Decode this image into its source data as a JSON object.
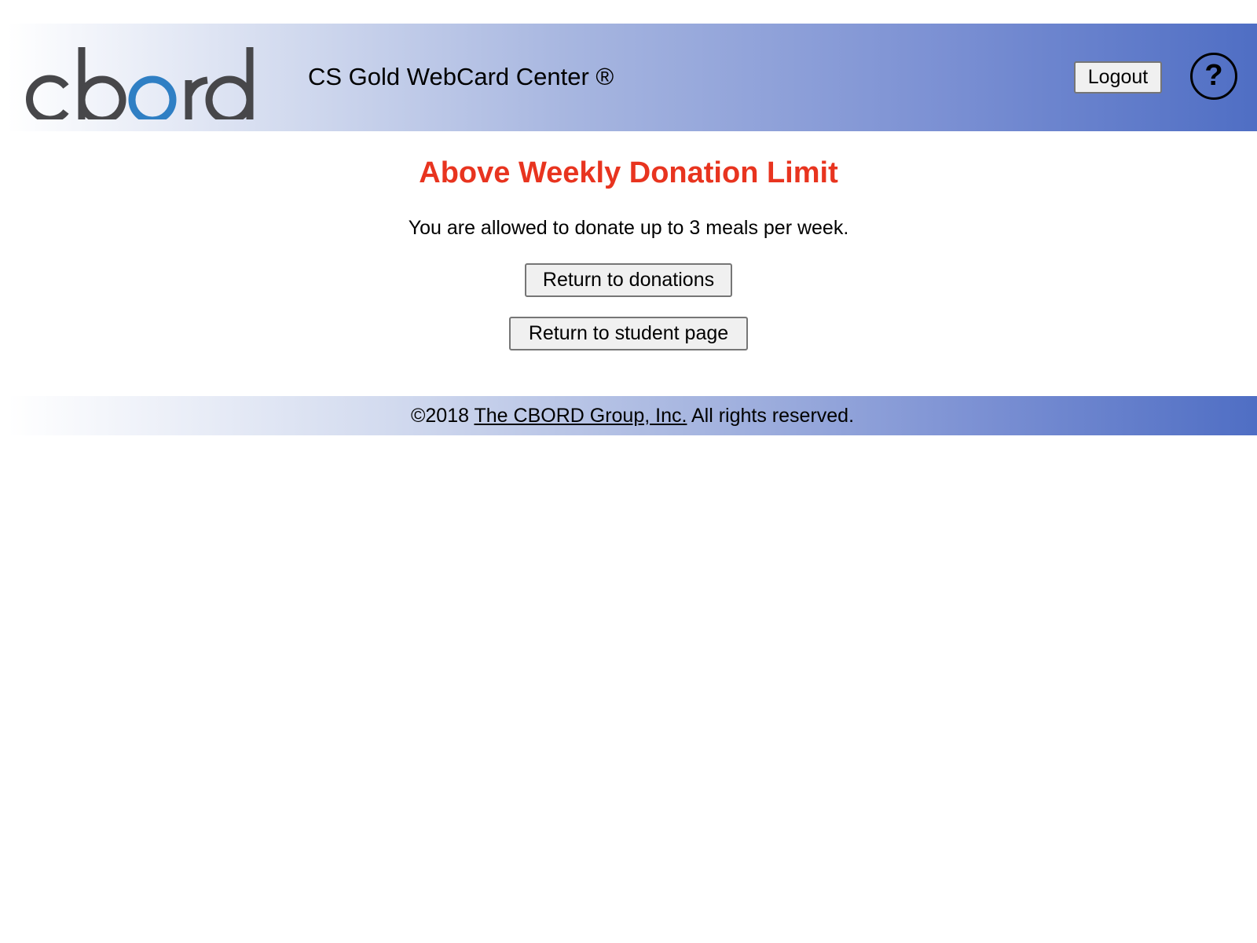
{
  "header": {
    "logo_text": "cbord",
    "logo_mark": "®",
    "app_title": "CS Gold WebCard Center ®",
    "logout_label": "Logout",
    "help_label": "?",
    "colors": {
      "logo_gray": "#47474a",
      "logo_blue": "#2f7fc4",
      "gradient_end": "#4f6ec4"
    }
  },
  "main": {
    "title": "Above Weekly Donation Limit",
    "title_color": "#e8341f",
    "message": "You are allowed to donate up to 3 meals per week.",
    "buttons": {
      "return_donations": "Return to donations",
      "return_student": "Return to student page"
    }
  },
  "footer": {
    "prefix": "©2018 ",
    "link_text": "The CBORD Group, Inc.",
    "suffix": " All rights reserved."
  }
}
